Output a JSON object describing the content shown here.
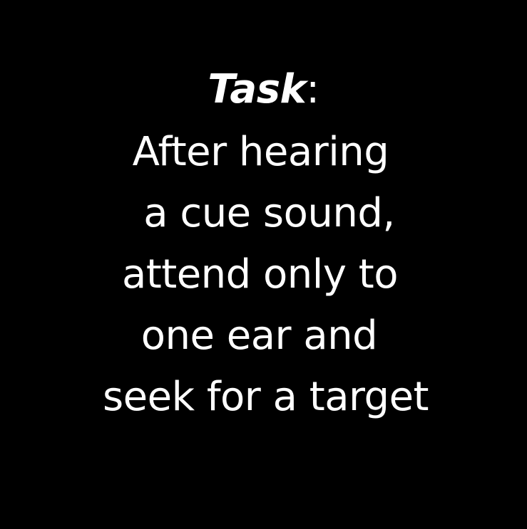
{
  "heading": {
    "word": "Task",
    "suffix": ":"
  },
  "body_lines": [
    "After hearing",
    "a cue sound,",
    "attend only to",
    "one ear and",
    "seek for a target"
  ]
}
